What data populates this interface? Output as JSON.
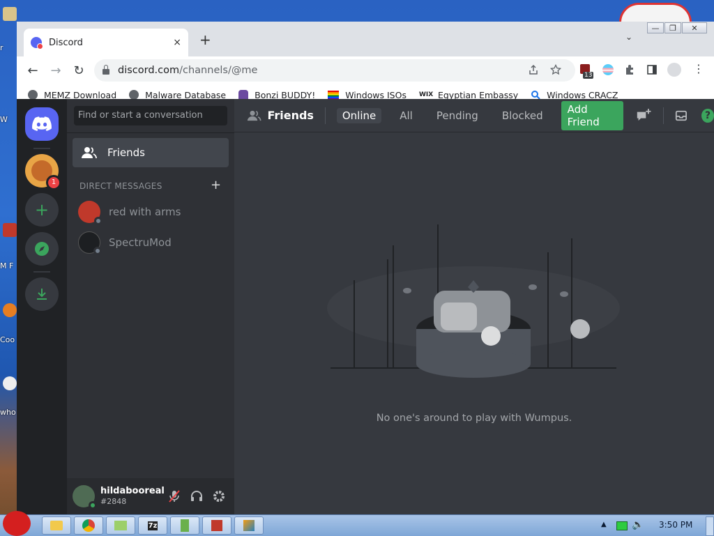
{
  "desktop": {
    "icon_labels": [
      "r",
      "W",
      "M F",
      "Coo",
      "who u"
    ]
  },
  "browser": {
    "window_controls": [
      "—",
      "❐",
      "✕"
    ],
    "tab": {
      "title": "Discord",
      "close": "×"
    },
    "new_tab": "+",
    "tab_search": "⌄",
    "nav": {
      "back": "←",
      "forward": "→",
      "reload": "↻"
    },
    "address": {
      "host": "discord.com",
      "path": "/channels/@me"
    },
    "ext_badge": "13",
    "bookmarks": [
      {
        "label": "MEMZ Download",
        "icon": "globe-icon",
        "color": "#5f6368"
      },
      {
        "label": "Malware Database",
        "icon": "globe-icon",
        "color": "#5f6368"
      },
      {
        "label": "Bonzi BUDDY!",
        "icon": "bonzi-icon",
        "color": "#6b4aa0"
      },
      {
        "label": "Windows ISOs",
        "icon": "rainbow-flag-icon",
        "color": "#e03030"
      },
      {
        "label": "Egyptian Embassy",
        "icon": "wix-icon",
        "color": "#000000"
      },
      {
        "label": "Windows CRACZ",
        "icon": "search-icon",
        "color": "#1a73e8"
      }
    ]
  },
  "discord": {
    "guild_badge": "1",
    "search_placeholder": "Find or start a conversation",
    "friends_label": "Friends",
    "dm_header": "DIRECT MESSAGES",
    "dm_add": "+",
    "dms": [
      {
        "name": "red with arms",
        "avatar_color": "#c0392b"
      },
      {
        "name": "SpectruMod",
        "avatar_color": "#1d1f22"
      }
    ],
    "user": {
      "name": "hildabooreal",
      "tag": "#2848"
    },
    "header": {
      "title": "Friends",
      "tabs": [
        "Online",
        "All",
        "Pending",
        "Blocked"
      ],
      "add_friend": "Add Friend",
      "help": "?"
    },
    "empty_message": "No one's around to play with Wumpus."
  },
  "taskbar": {
    "clock": "3:50 PM"
  },
  "colors": {
    "blurple": "#5865f2",
    "green": "#3ba55d",
    "red": "#ed4245",
    "bg_primary": "#36393f",
    "bg_secondary": "#2f3136",
    "bg_tertiary": "#202225"
  }
}
